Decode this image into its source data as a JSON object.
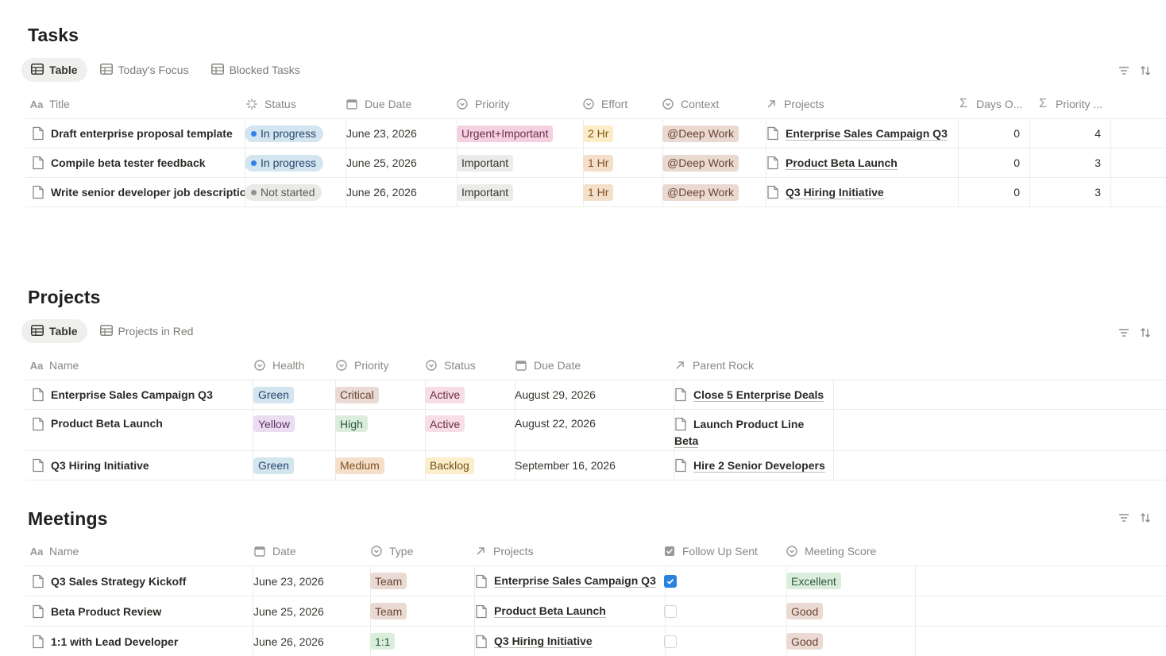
{
  "tasks": {
    "title": "Tasks",
    "views": [
      "Table",
      "Today's Focus",
      "Blocked Tasks"
    ],
    "columns": [
      "Title",
      "Status",
      "Due Date",
      "Priority",
      "Effort",
      "Context",
      "Projects",
      "Days O...",
      "Priority ..."
    ],
    "rows": [
      {
        "title": "Draft enterprise proposal template",
        "status": "In progress",
        "due": "June 23, 2026",
        "priority": "Urgent+Important",
        "effort": "2 Hr",
        "context": "@Deep Work",
        "project": "Enterprise Sales Campaign Q3",
        "days": "0",
        "pscore": "4"
      },
      {
        "title": "Compile beta tester feedback",
        "status": "In progress",
        "due": "June 25, 2026",
        "priority": "Important",
        "effort": "1 Hr",
        "context": "@Deep Work",
        "project": "Product Beta Launch",
        "days": "0",
        "pscore": "3"
      },
      {
        "title": "Write senior developer job description",
        "status": "Not started",
        "due": "June 26, 2026",
        "priority": "Important",
        "effort": "1 Hr",
        "context": "@Deep Work",
        "project": "Q3 Hiring Initiative",
        "days": "0",
        "pscore": "3"
      }
    ]
  },
  "projects": {
    "title": "Projects",
    "views": [
      "Table",
      "Projects in Red"
    ],
    "columns": [
      "Name",
      "Health",
      "Priority",
      "Status",
      "Due Date",
      "Parent Rock"
    ],
    "rows": [
      {
        "name": "Enterprise Sales Campaign Q3",
        "health": "Green",
        "priority": "Critical",
        "status": "Active",
        "due": "August 29, 2026",
        "parent": "Close 5 Enterprise Deals",
        "parent2": ""
      },
      {
        "name": "Product Beta Launch",
        "health": "Yellow",
        "priority": "High",
        "status": "Active",
        "due": "August 22, 2026",
        "parent": "Launch Product Line",
        "parent2": "Beta"
      },
      {
        "name": "Q3 Hiring Initiative",
        "health": "Green",
        "priority": "Medium",
        "status": "Backlog",
        "due": "September 16, 2026",
        "parent": "Hire 2 Senior Developers",
        "parent2": ""
      }
    ]
  },
  "meetings": {
    "title": "Meetings",
    "columns": [
      "Name",
      "Date",
      "Type",
      "Projects",
      "Follow Up Sent",
      "Meeting Score"
    ],
    "rows": [
      {
        "name": "Q3 Sales Strategy Kickoff",
        "date": "June 23, 2026",
        "type": "Team",
        "project": "Enterprise Sales Campaign Q3",
        "followup": true,
        "score": "Excellent"
      },
      {
        "name": "Beta Product Review",
        "date": "June 25, 2026",
        "type": "Team",
        "project": "Product Beta Launch",
        "followup": false,
        "score": "Good"
      },
      {
        "name": "1:1 with Lead Developer",
        "date": "June 26, 2026",
        "type": "1:1",
        "project": "Q3 Hiring Initiative",
        "followup": false,
        "score": "Good"
      }
    ]
  },
  "colors": {
    "status_in_progress_bg": "#d3e5ef",
    "status_in_progress_dot": "#2f80ed",
    "status_not_started_bg": "#e9e9e7",
    "status_not_started_dot": "#91918e",
    "urgent_bg": "#f5d0e0",
    "important_bg": "#ebebea",
    "effort_bg": "#fdecc8",
    "context_bg": "#ead9d1",
    "green_bg": "#dbeddb",
    "yellow_bg": "#ecdcf2",
    "critical_bg": "#eadad3",
    "high_bg": "#dbeddb",
    "medium_bg": "#f4dfcb",
    "active_bg": "#f7dde6",
    "backlog_bg": "#fbeecb",
    "team_bg": "#eadad3",
    "one_on_one_bg": "#dbeddb",
    "excellent_bg": "#dbeddb",
    "good_bg": "#eadad3",
    "checkbox_blue": "#2783de"
  },
  "icons": {
    "table_view": "table-icon",
    "title_prop": "text-aa-icon",
    "status_prop": "loading-icon",
    "date_prop": "calendar-icon",
    "select_prop": "select-icon",
    "relation_prop": "arrow-up-right-icon",
    "formula_prop": "sigma-icon",
    "checkbox_prop": "checkbox-icon",
    "filter": "filter-icon",
    "sort": "sort-icon",
    "page": "page-icon"
  }
}
